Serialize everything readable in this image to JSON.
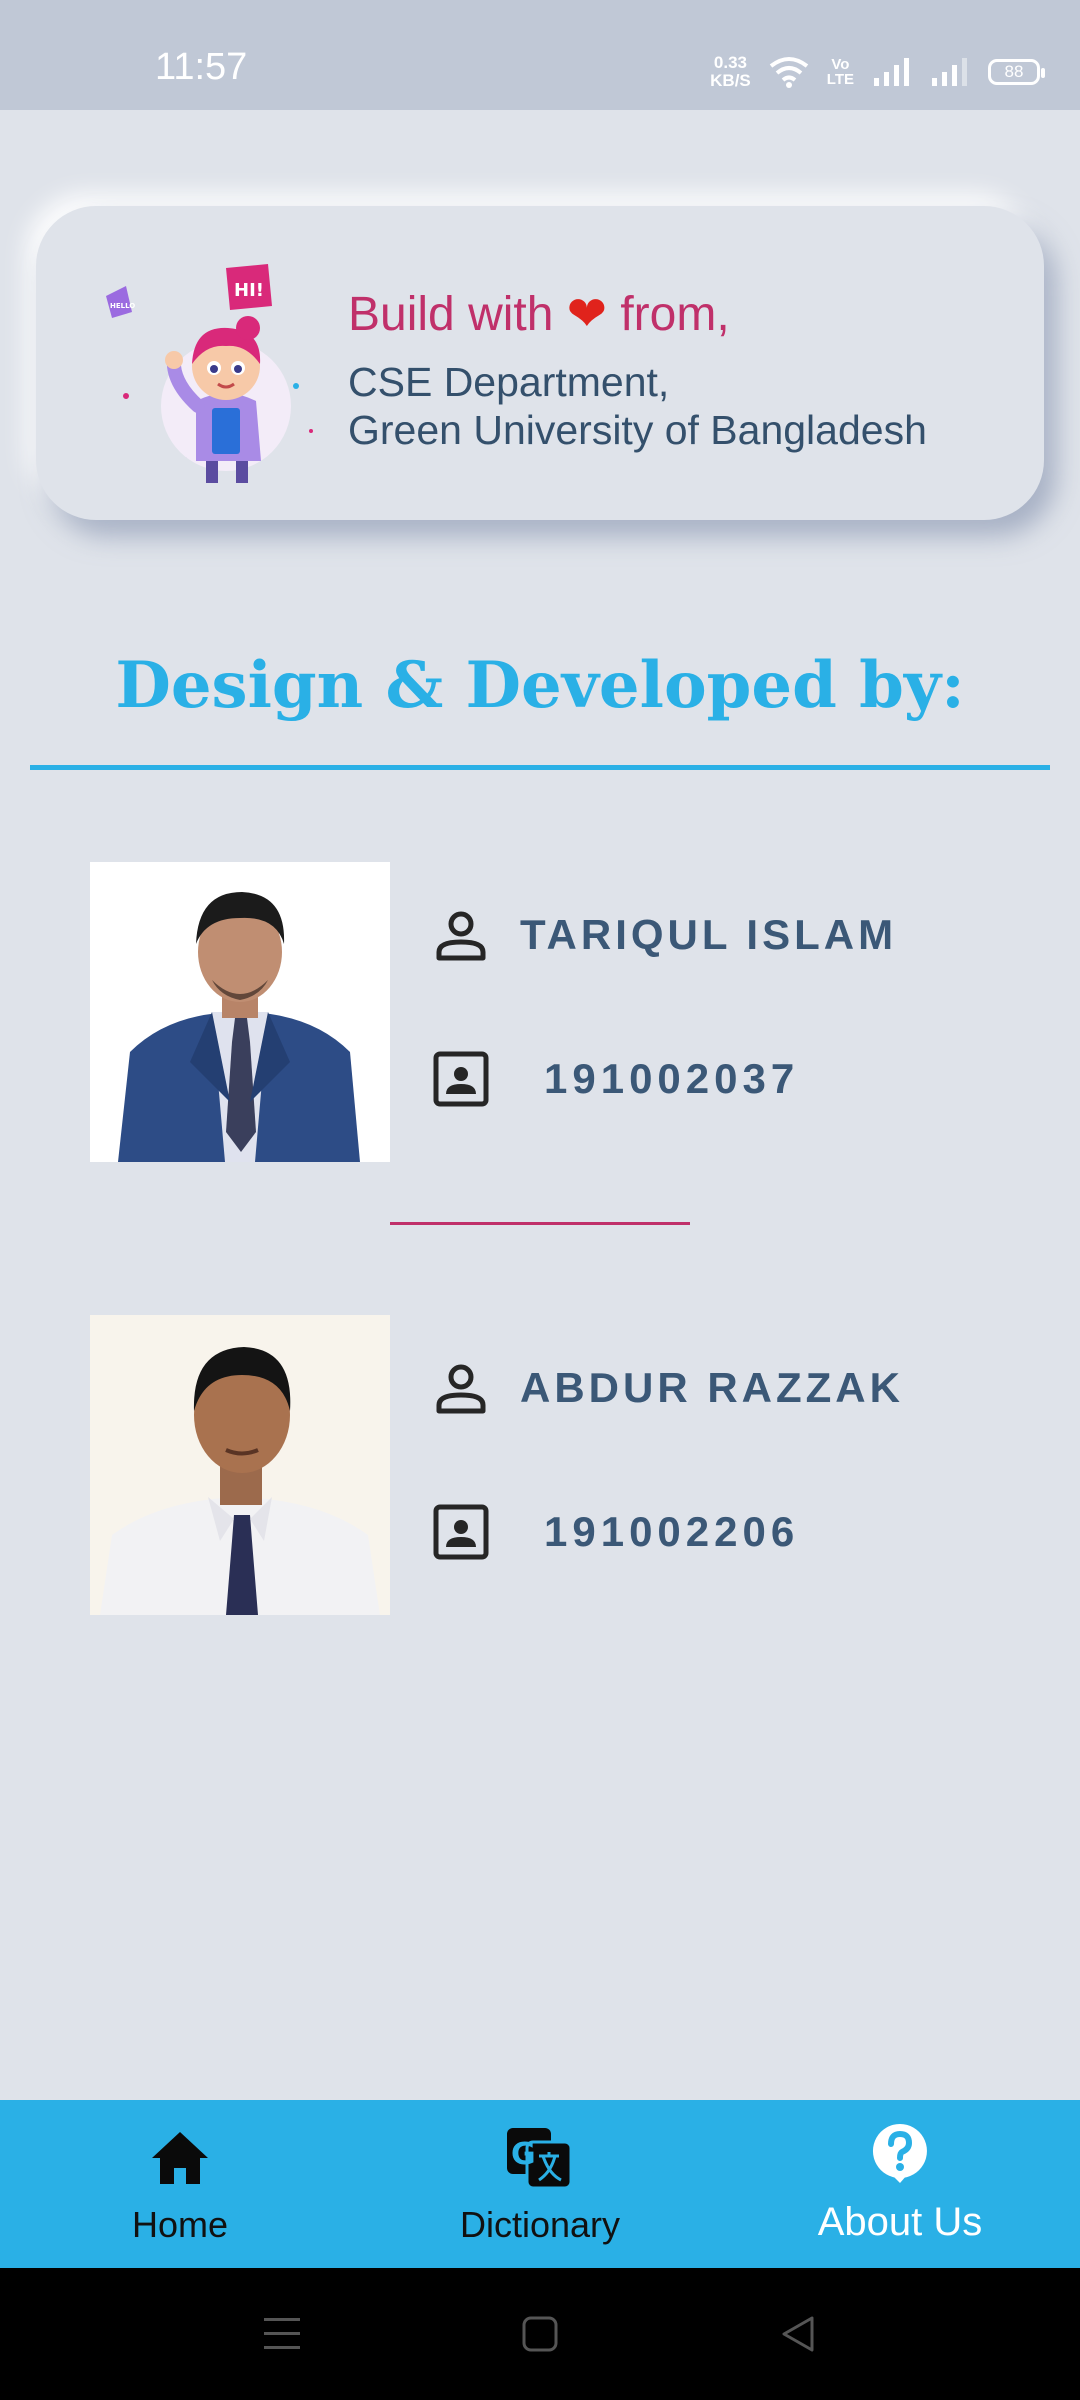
{
  "status_bar": {
    "time": "11:57",
    "net_speed_value": "0.33",
    "net_speed_unit": "KB/S",
    "volte_top": "Vo",
    "volte_bottom": "LTE",
    "battery": "88"
  },
  "credit": {
    "prefix": "Build with",
    "heart": "❤",
    "suffix": "from,",
    "department": "CSE Department,",
    "university": "Green University of Bangladesh",
    "illustration_sign_hi": "HI!",
    "illustration_sign_hello": "HELLO"
  },
  "section_title": "Design & Developed by:",
  "developers": [
    {
      "name": "TARIQUL ISLAM",
      "id": "191002037"
    },
    {
      "name": "ABDUR RAZZAK",
      "id": "191002206"
    }
  ],
  "bottom_nav": {
    "items": [
      {
        "label": "Home",
        "icon": "home-icon"
      },
      {
        "label": "Dictionary",
        "icon": "translate-icon"
      },
      {
        "label": "About Us",
        "icon": "help-circle-icon"
      }
    ],
    "active": "About Us"
  },
  "colors": {
    "background": "#dfe3ea",
    "accent": "#2ab0e6",
    "credit_pink": "#c0306a",
    "text_blue": "#3b5877"
  }
}
